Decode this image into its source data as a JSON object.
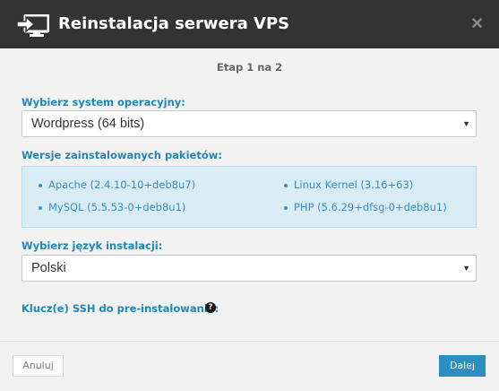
{
  "dialog": {
    "title": "Reinstalacja serwera VPS",
    "icon": "monitor-reinstall-icon",
    "close_label": "×"
  },
  "step": "Etap 1 na 2",
  "os_select": {
    "label": "Wybierz system operacyjny:",
    "value": "Wordpress (64 bits)"
  },
  "packages": {
    "label": "Wersje zainstalowanych pakietów:",
    "items": [
      "Apache (2.4.10-10+deb8u7)",
      "MySQL (5.5.53-0+deb8u1)",
      "Linux Kernel (3.16+63)",
      "PHP (5.6.29+dfsg-0+deb8u1)"
    ]
  },
  "language_select": {
    "label": "Wybierz język instalacji:",
    "value": "Polski"
  },
  "ssh_keys": {
    "label": "Klucz(e) SSH do pre-instalowania:",
    "help_icon": "?"
  },
  "footer": {
    "cancel_label": "Anuluj",
    "next_label": "Dalej"
  },
  "colors": {
    "header_bg": "#333333",
    "accent": "#1e88b4",
    "info_box_bg": "#d8ecf5",
    "primary_button": "#2d8fc0"
  }
}
